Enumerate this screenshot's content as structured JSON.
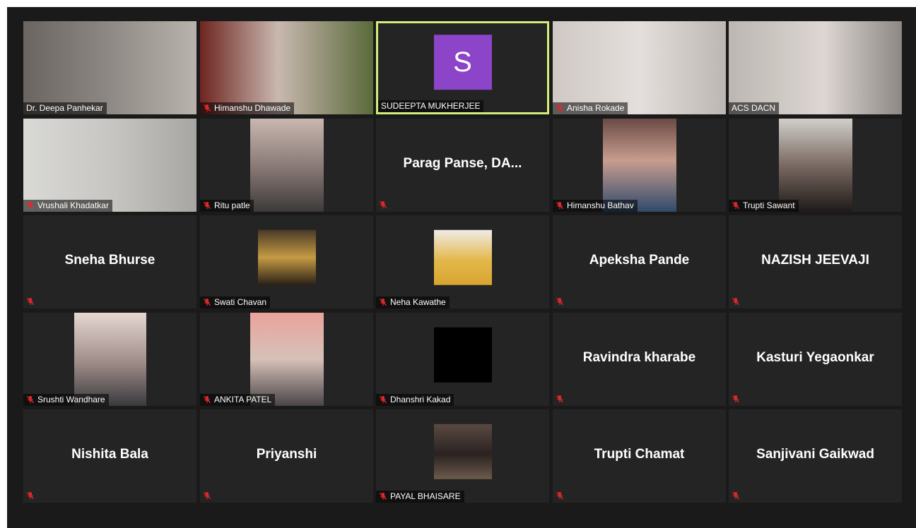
{
  "meeting": {
    "participants": [
      {
        "label": "Dr. Deepa Panhekar",
        "big_name": "",
        "muted": false,
        "video": "full",
        "active": false
      },
      {
        "label": "Himanshu Dhawade",
        "big_name": "",
        "muted": true,
        "video": "full",
        "active": false
      },
      {
        "label": "SUDEEPTA MUKHERJEE",
        "big_name": "",
        "muted": false,
        "video": "avatar",
        "avatar_letter": "S",
        "active": true
      },
      {
        "label": "Anisha Rokade",
        "big_name": "",
        "muted": true,
        "video": "full",
        "active": false
      },
      {
        "label": "ACS DACN",
        "big_name": "",
        "muted": false,
        "video": "full",
        "active": false
      },
      {
        "label": "Vrushali Khadatkar",
        "big_name": "",
        "muted": true,
        "video": "full",
        "active": false
      },
      {
        "label": "Ritu patle",
        "big_name": "",
        "muted": true,
        "video": "center",
        "active": false
      },
      {
        "label": "",
        "big_name": "Parag  Panse, DA...",
        "muted": true,
        "video": "none",
        "active": false
      },
      {
        "label": "Himanshu Bathav",
        "big_name": "",
        "muted": true,
        "video": "center",
        "active": false
      },
      {
        "label": "Trupti Sawant",
        "big_name": "",
        "muted": true,
        "video": "center",
        "active": false
      },
      {
        "label": "",
        "big_name": "Sneha Bhurse",
        "muted": true,
        "video": "none",
        "active": false
      },
      {
        "label": "Swati Chavan",
        "big_name": "",
        "muted": true,
        "video": "thumb",
        "active": false
      },
      {
        "label": "Neha Kawathe",
        "big_name": "",
        "muted": true,
        "video": "thumb",
        "active": false
      },
      {
        "label": "",
        "big_name": "Apeksha Pande",
        "muted": true,
        "video": "none",
        "active": false
      },
      {
        "label": "",
        "big_name": "NAZISH JEEVAJI",
        "muted": true,
        "video": "none",
        "active": false
      },
      {
        "label": "Srushti Wandhare",
        "big_name": "",
        "muted": true,
        "video": "center",
        "active": false
      },
      {
        "label": "ANKITA PATEL",
        "big_name": "",
        "muted": true,
        "video": "center",
        "active": false
      },
      {
        "label": "Dhanshri Kakad",
        "big_name": "",
        "muted": true,
        "video": "black",
        "active": false
      },
      {
        "label": "",
        "big_name": "Ravindra kharabe",
        "muted": true,
        "video": "none",
        "active": false
      },
      {
        "label": "",
        "big_name": "Kasturi Yegaonkar",
        "muted": true,
        "video": "none",
        "active": false
      },
      {
        "label": "",
        "big_name": "Nishita Bala",
        "muted": true,
        "video": "none",
        "active": false
      },
      {
        "label": "",
        "big_name": "Priyanshi",
        "muted": true,
        "video": "none",
        "active": false
      },
      {
        "label": "PAYAL BHAISARE",
        "big_name": "",
        "muted": true,
        "video": "thumb",
        "active": false
      },
      {
        "label": "",
        "big_name": "Trupti  Chamat",
        "muted": true,
        "video": "none",
        "active": false
      },
      {
        "label": "",
        "big_name": "Sanjivani Gaikwad",
        "muted": true,
        "video": "none",
        "active": false
      }
    ]
  },
  "colors": {
    "background": "#1a1a1a",
    "tile": "#242424",
    "active_border": "#d4ee7a",
    "avatar": "#8c44c8",
    "mute_icon": "#e02828"
  },
  "icons": {
    "muted": "microphone-muted-icon"
  }
}
